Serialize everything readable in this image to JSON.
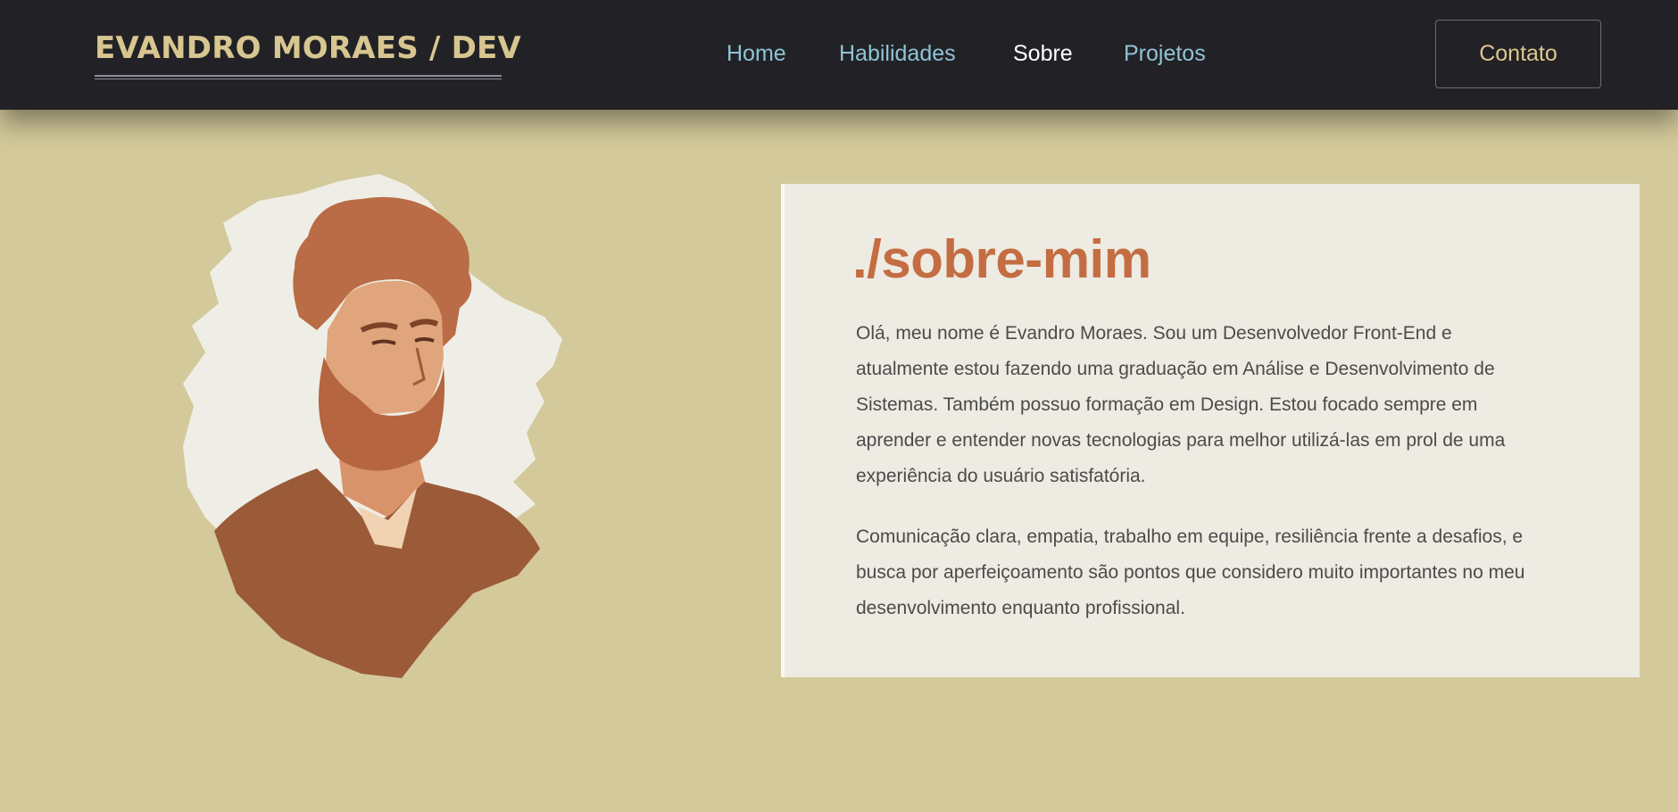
{
  "header": {
    "logo": "EVANDRO MORAES / DEV",
    "nav": [
      {
        "label": "Home",
        "active": false
      },
      {
        "label": "Habilidades",
        "active": false
      },
      {
        "label": "Sobre",
        "active": true
      },
      {
        "label": "Projetos",
        "active": false
      }
    ],
    "contact_label": "Contato"
  },
  "about": {
    "title": "./sobre-mim",
    "paragraphs": [
      "Olá, meu nome é Evandro Moraes. Sou um Desenvolvedor Front-End e atualmente estou fazendo uma graduação em Análise e Desenvolvimento de Sistemas. Também possuo formação em Design. Estou focado sempre em aprender e entender novas tecnologias para melhor utilizá-las em prol de uma experiência do usuário satisfatória.",
      "Comunicação clara, empatia, trabalho em equipe, resiliência frente a desafios, e busca por aperfeiçoamento são pontos que considero muito importantes no meu desenvolvimento enquanto profissional."
    ]
  },
  "colors": {
    "page_background": "#d3c99a",
    "navbar": "#222226",
    "logo": "#d8c690",
    "nav_link": "#8fc3d6",
    "nav_active": "#ffffff",
    "title_accent": "#c46d42",
    "card_background": "#edebe2",
    "portrait_tint": "#c1784d"
  }
}
